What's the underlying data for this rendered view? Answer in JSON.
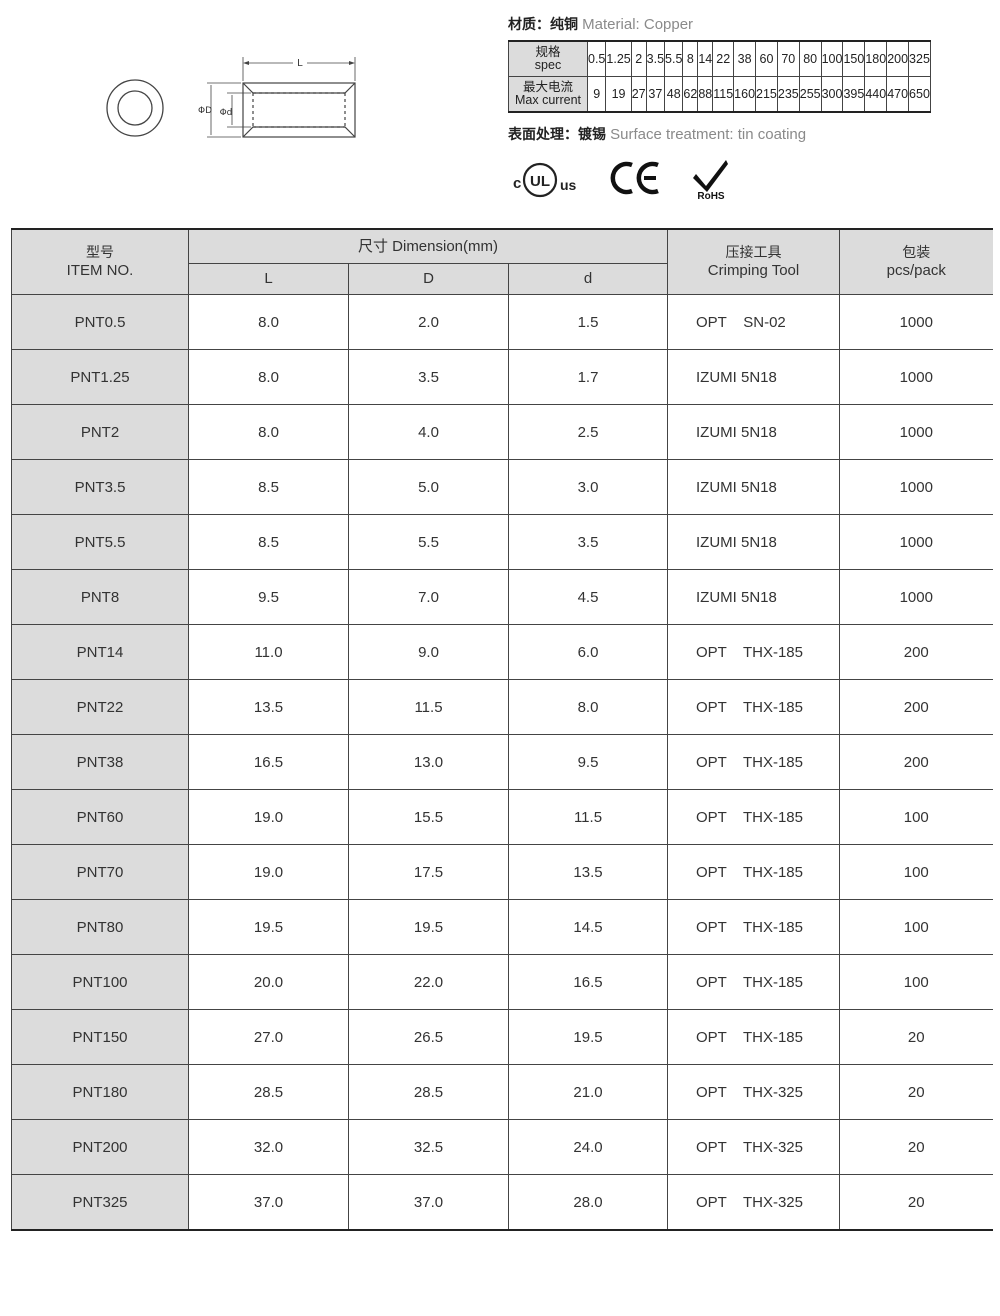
{
  "material": {
    "label_zh": "材质：纯铜",
    "label_en": "Material: Copper"
  },
  "surface": {
    "label_zh": "表面处理：镀锡",
    "label_en": "Surface treatment: tin coating"
  },
  "drawing": {
    "dim_L": "L",
    "dim_D": "ΦD",
    "dim_d": "Φd"
  },
  "spec_table": {
    "row1_label_zh": "规格",
    "row1_label_en": "spec",
    "row2_label_zh": "最大电流",
    "row2_label_en": "Max current",
    "spec": [
      "0.5",
      "1.25",
      "2",
      "3.5",
      "5.5",
      "8",
      "14",
      "22",
      "38",
      "60",
      "70",
      "80",
      "100",
      "150",
      "180",
      "200",
      "325"
    ],
    "current": [
      "9",
      "19",
      "27",
      "37",
      "48",
      "62",
      "88",
      "115",
      "160",
      "215",
      "235",
      "255",
      "300",
      "395",
      "440",
      "470",
      "650"
    ]
  },
  "certs": {
    "ul_left": "c",
    "ul_mid": "UL",
    "ul_right": "us",
    "ce": "CE",
    "rohs": "RoHS"
  },
  "table": {
    "headers": {
      "item_zh": "型号",
      "item_en": "ITEM NO.",
      "dimension": "尺寸 Dimension(mm)",
      "L": "L",
      "D": "D",
      "d": "d",
      "tool_zh": "压接工具",
      "tool_en": "Crimping Tool",
      "pack_zh": "包装",
      "pack_en": "pcs/pack"
    },
    "rows": [
      {
        "item": "PNT0.5",
        "L": "8.0",
        "D": "2.0",
        "d": "1.5",
        "tool": "OPT    SN-02",
        "pack": "1000"
      },
      {
        "item": "PNT1.25",
        "L": "8.0",
        "D": "3.5",
        "d": "1.7",
        "tool": "IZUMI 5N18",
        "pack": "1000"
      },
      {
        "item": "PNT2",
        "L": "8.0",
        "D": "4.0",
        "d": "2.5",
        "tool": "IZUMI 5N18",
        "pack": "1000"
      },
      {
        "item": "PNT3.5",
        "L": "8.5",
        "D": "5.0",
        "d": "3.0",
        "tool": "IZUMI 5N18",
        "pack": "1000"
      },
      {
        "item": "PNT5.5",
        "L": "8.5",
        "D": "5.5",
        "d": "3.5",
        "tool": "IZUMI 5N18",
        "pack": "1000"
      },
      {
        "item": "PNT8",
        "L": "9.5",
        "D": "7.0",
        "d": "4.5",
        "tool": "IZUMI 5N18",
        "pack": "1000"
      },
      {
        "item": "PNT14",
        "L": "11.0",
        "D": "9.0",
        "d": "6.0",
        "tool": "OPT    THX-185",
        "pack": "200"
      },
      {
        "item": "PNT22",
        "L": "13.5",
        "D": "11.5",
        "d": "8.0",
        "tool": "OPT    THX-185",
        "pack": "200"
      },
      {
        "item": "PNT38",
        "L": "16.5",
        "D": "13.0",
        "d": "9.5",
        "tool": "OPT    THX-185",
        "pack": "200"
      },
      {
        "item": "PNT60",
        "L": "19.0",
        "D": "15.5",
        "d": "11.5",
        "tool": "OPT    THX-185",
        "pack": "100"
      },
      {
        "item": "PNT70",
        "L": "19.0",
        "D": "17.5",
        "d": "13.5",
        "tool": "OPT    THX-185",
        "pack": "100"
      },
      {
        "item": "PNT80",
        "L": "19.5",
        "D": "19.5",
        "d": "14.5",
        "tool": "OPT    THX-185",
        "pack": "100"
      },
      {
        "item": "PNT100",
        "L": "20.0",
        "D": "22.0",
        "d": "16.5",
        "tool": "OPT    THX-185",
        "pack": "100"
      },
      {
        "item": "PNT150",
        "L": "27.0",
        "D": "26.5",
        "d": "19.5",
        "tool": "OPT    THX-185",
        "pack": "20"
      },
      {
        "item": "PNT180",
        "L": "28.5",
        "D": "28.5",
        "d": "21.0",
        "tool": "OPT    THX-325",
        "pack": "20"
      },
      {
        "item": "PNT200",
        "L": "32.0",
        "D": "32.5",
        "d": "24.0",
        "tool": "OPT    THX-325",
        "pack": "20"
      },
      {
        "item": "PNT325",
        "L": "37.0",
        "D": "37.0",
        "d": "28.0",
        "tool": "OPT    THX-325",
        "pack": "20"
      }
    ]
  },
  "colors": {
    "header_fill": "#dcdcdc",
    "rule": "#444444",
    "muted_text": "#8a8a8a"
  }
}
